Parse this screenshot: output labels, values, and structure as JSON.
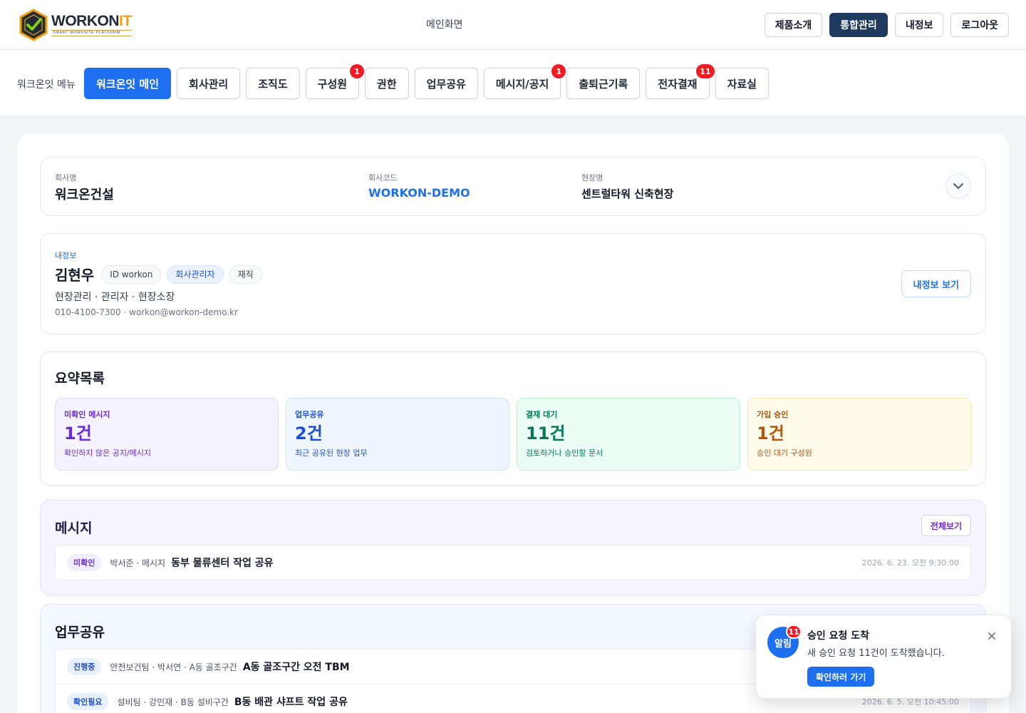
{
  "brand": {
    "name_main": "WORKON",
    "name_accent": "IT",
    "tagline": "SMART WORKSITE PLATFORM"
  },
  "header": {
    "home_link": "메인화면",
    "buttons": [
      "제품소개",
      "통합관리",
      "내정보",
      "로그아웃"
    ],
    "active_button": "통합관리"
  },
  "menu": {
    "label": "워크온잇 메뉴",
    "items": [
      {
        "label": "워크온잇 메인",
        "active": true,
        "badge": ""
      },
      {
        "label": "회사관리",
        "badge": ""
      },
      {
        "label": "조직도",
        "badge": ""
      },
      {
        "label": "구성원",
        "badge": "1"
      },
      {
        "label": "권한",
        "badge": ""
      },
      {
        "label": "업무공유",
        "badge": ""
      },
      {
        "label": "메시지/공지",
        "badge": "1"
      },
      {
        "label": "출퇴근기록",
        "badge": ""
      },
      {
        "label": "전자결재",
        "badge": "11"
      },
      {
        "label": "자료실",
        "badge": ""
      }
    ]
  },
  "company": {
    "name_label": "회사명",
    "name": "워크온건설",
    "code_label": "회사코드",
    "code": "WORKON-DEMO",
    "site_label": "현장명",
    "site": "센트럴타워 신축현장"
  },
  "profile": {
    "kicker": "내정보",
    "name": "김현우",
    "chips": [
      "ID workon",
      "회사관리자",
      "재직"
    ],
    "role": "현장관리 · 관리자 · 현장소장",
    "contact": "010-4100-7300 · workon@workon-demo.kr",
    "button": "내정보 보기"
  },
  "summary": {
    "title": "요약목록",
    "cards": [
      {
        "label": "미확인 메시지",
        "value": "1건",
        "desc": "확인하지 않은 공지/메시지",
        "color": "#6d28d9",
        "bg": "#f5f3ff",
        "border": "#ddd6fe"
      },
      {
        "label": "업무공유",
        "value": "2건",
        "desc": "최근 공유된 현장 업무",
        "color": "#1d4ed8",
        "bg": "#eff6ff",
        "border": "#cfe0fb"
      },
      {
        "label": "결재 대기",
        "value": "11건",
        "desc": "검토하거나 승인할 문서",
        "color": "#047857",
        "bg": "#ecfdf5",
        "border": "#bbf0d6"
      },
      {
        "label": "가입 승인",
        "value": "1건",
        "desc": "승인 대기 구성원",
        "color": "#b45309",
        "bg": "#fffbeb",
        "border": "#f8e6b0"
      }
    ]
  },
  "messages": {
    "title": "메시지",
    "all_button": "전체보기",
    "rows": [
      {
        "tag": "미확인",
        "meta": "박서준 · 메시지",
        "title": "동부 물류센터 작업 공유",
        "time": "2026. 6. 23. 오전 9:30:00"
      }
    ]
  },
  "work": {
    "title": "업무공유",
    "rows": [
      {
        "tag": "진행중",
        "meta": "안전보건팀 · 박서연 · A동 골조구간",
        "title": "A동 골조구간 오전 TBM",
        "time": ""
      },
      {
        "tag": "확인필요",
        "meta": "설비팀 · 강민재 · B동 설비구간",
        "title": "B동 배관 샤프트 작업 공유",
        "time": "2026. 6. 5. 오전 10:45:00"
      }
    ]
  },
  "toast": {
    "avatar": "알림",
    "badge": "11",
    "title": "승인 요청 도착",
    "message": "새 승인 요청 11건이 도착했습니다.",
    "button": "확인하러 가기"
  },
  "colors": {
    "primary": "#1d6ff0",
    "navy": "#1e3a5f",
    "badge_red": "#ef1c24"
  }
}
